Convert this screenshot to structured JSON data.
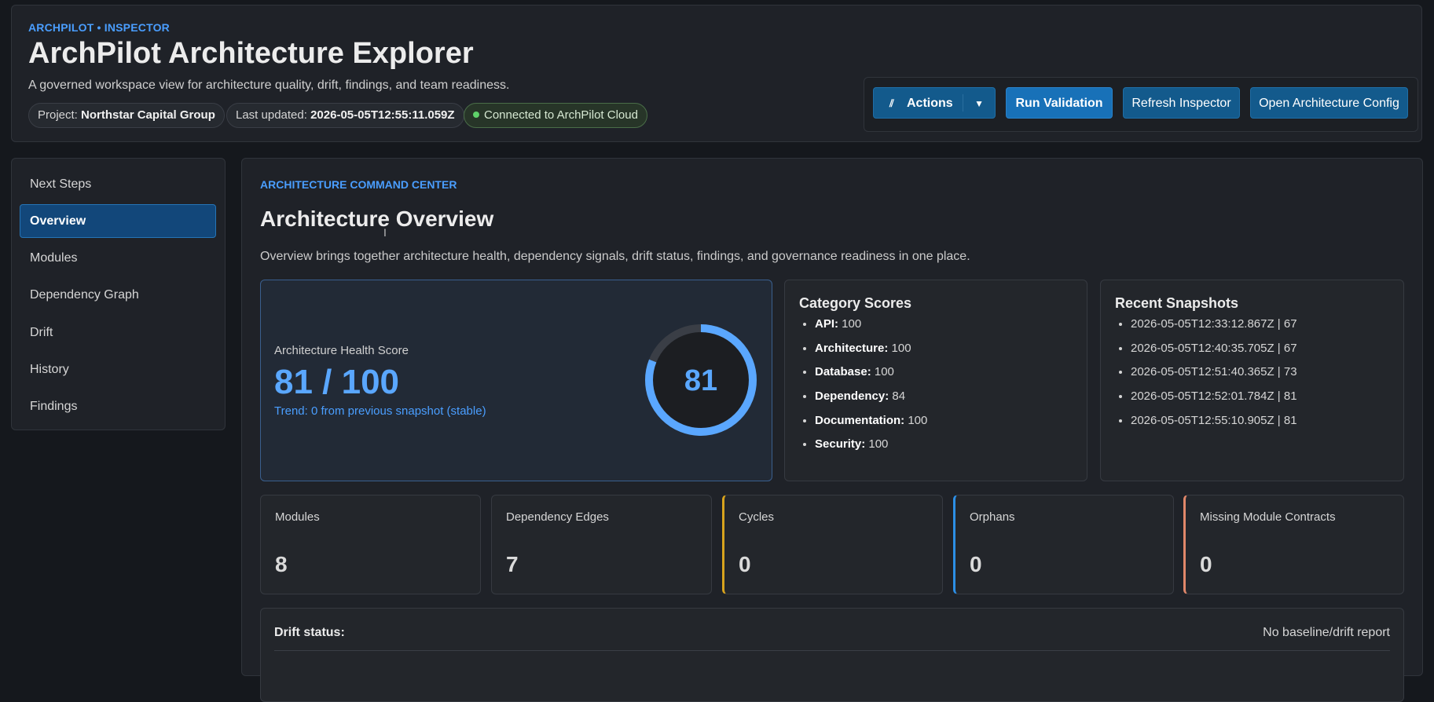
{
  "header": {
    "eyebrow": "ARCHPILOT • INSPECTOR",
    "title": "ArchPilot Architecture Explorer",
    "subtitle": "A governed workspace view for architecture quality, drift, findings, and team readiness.",
    "project_label": "Project:",
    "project_value": "Northstar Capital Group",
    "updated_label": "Last updated:",
    "updated_value": "2026-05-05T12:55:11.059Z",
    "connection": "Connected to ArchPilot Cloud"
  },
  "actions": {
    "actions_label": "Actions",
    "run_validation": "Run Validation",
    "refresh_inspector": "Refresh Inspector",
    "open_config": "Open Architecture Config"
  },
  "sidebar": {
    "items": [
      {
        "label": "Next Steps"
      },
      {
        "label": "Overview",
        "active": true
      },
      {
        "label": "Modules"
      },
      {
        "label": "Dependency Graph"
      },
      {
        "label": "Drift"
      },
      {
        "label": "History"
      },
      {
        "label": "Findings"
      }
    ]
  },
  "main": {
    "eyebrow": "ARCHITECTURE COMMAND CENTER",
    "title": "Architecture Overview",
    "description": "Overview brings together architecture health, dependency signals, drift status, findings, and governance readiness in one place.",
    "health": {
      "label": "Architecture Health Score",
      "score": "81 / 100",
      "trend": "Trend: 0 from previous snapshot (stable)",
      "gauge_value": "81",
      "gauge_fraction": 0.81
    },
    "category_scores": {
      "title": "Category Scores",
      "items": [
        {
          "name": "API:",
          "value": "100"
        },
        {
          "name": "Architecture:",
          "value": "100"
        },
        {
          "name": "Database:",
          "value": "100"
        },
        {
          "name": "Dependency:",
          "value": "84"
        },
        {
          "name": "Documentation:",
          "value": "100"
        },
        {
          "name": "Security:",
          "value": "100"
        }
      ]
    },
    "recent_snapshots": {
      "title": "Recent Snapshots",
      "items": [
        "2026-05-05T12:33:12.867Z | 67",
        "2026-05-05T12:40:35.705Z | 67",
        "2026-05-05T12:51:40.365Z | 73",
        "2026-05-05T12:52:01.784Z | 81",
        "2026-05-05T12:55:10.905Z | 81"
      ]
    },
    "stats": [
      {
        "label": "Modules",
        "value": "8"
      },
      {
        "label": "Dependency Edges",
        "value": "7"
      },
      {
        "label": "Cycles",
        "value": "0"
      },
      {
        "label": "Orphans",
        "value": "0"
      },
      {
        "label": "Missing Module Contracts",
        "value": "0"
      }
    ],
    "drift": {
      "label": "Drift status:",
      "value": "No baseline/drift report"
    }
  },
  "colors": {
    "accent": "#4a9eff",
    "primary_button": "#1871b8",
    "connected": "#5fd16a",
    "cycles_border": "#d8a31d",
    "orphans_border": "#2c8fe6",
    "contracts_border": "#e0876a"
  }
}
